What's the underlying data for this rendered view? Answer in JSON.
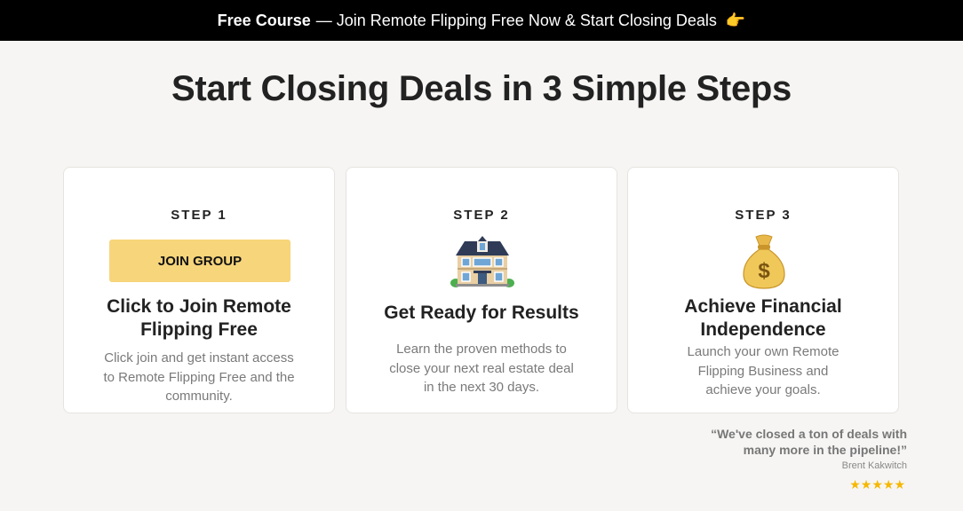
{
  "banner": {
    "bold": "Free Course",
    "text": "— Join Remote Flipping Free Now & Start Closing Deals",
    "icon": "pointing-hand-icon",
    "emoji": "👉"
  },
  "headline": "Start Closing Deals in 3 Simple Steps",
  "steps": [
    {
      "label": "STEP 1",
      "button": "JOIN GROUP",
      "title": "Click to Join Remote Flipping Free",
      "description": "Click join and get instant access to Remote Flipping Free and the community."
    },
    {
      "label": "STEP 2",
      "icon": "house-icon",
      "title": "Get Ready for Results",
      "description": "Learn the proven methods to close your next real estate deal in the next 30 days."
    },
    {
      "label": "STEP 3",
      "icon": "money-bag-icon",
      "title": "Achieve Financial Independence",
      "description": "Launch your own Remote Flipping Business and achieve your goals."
    }
  ],
  "testimonial": {
    "quote": "“We've closed a ton of deals with many more in the pipeline!”",
    "author": "Brent Kakwitch",
    "stars": "★★★★★"
  },
  "colors": {
    "banner_bg": "#000000",
    "page_bg": "#f6f5f3",
    "button_bg": "#f7d57b",
    "star": "#f5b700"
  }
}
